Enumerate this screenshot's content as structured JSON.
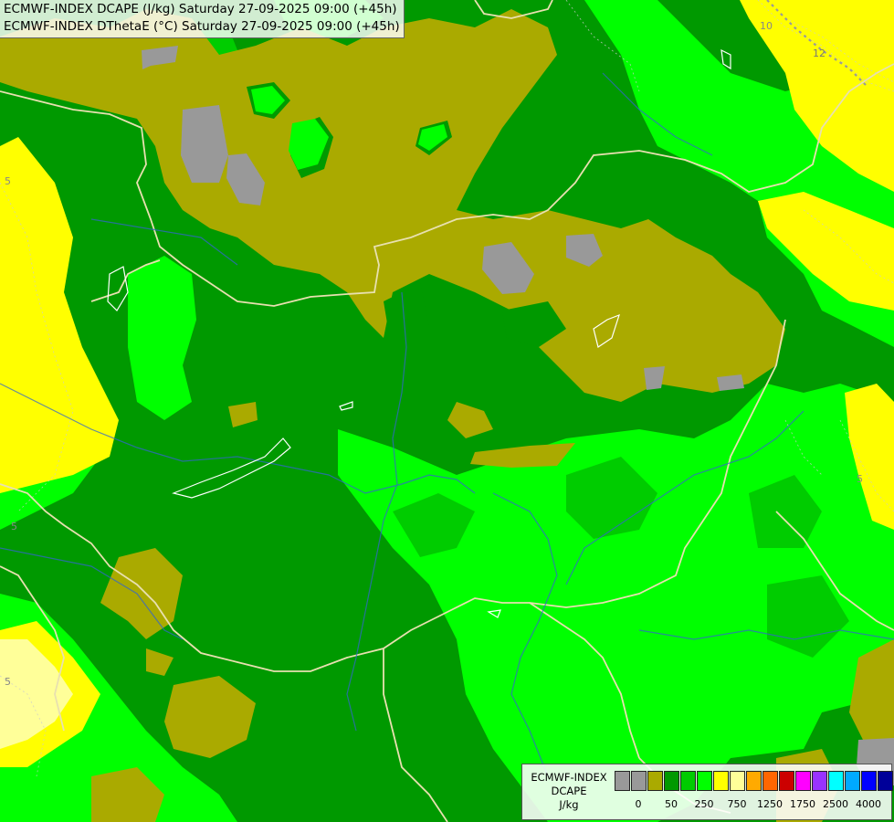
{
  "title": {
    "line1": "ECMWF-INDEX DCAPE (J/kg) Saturday 27-09-2025 09:00 (+45h)",
    "line2": "ECMWF-INDEX DThetaE (°C) Saturday 27-09-2025 09:00 (+45h)"
  },
  "legend": {
    "line1": "ECMWF-INDEX",
    "line2": "DCAPE",
    "unit": "J/kg",
    "colors": [
      "#999999",
      "#999999",
      "#aaaa00",
      "#009900",
      "#00cc00",
      "#00ff00",
      "#ffff00",
      "#ffff99",
      "#ffaa00",
      "#ff6600",
      "#cc0000",
      "#ff00ff",
      "#9933ff",
      "#00ffff",
      "#00aaff",
      "#0000ff",
      "#000099"
    ],
    "ticks": [
      "0",
      "50",
      "250",
      "750",
      "1250",
      "1750",
      "2500",
      "4000"
    ]
  },
  "contour_labels": [
    "5",
    "5",
    "5",
    "5",
    "10",
    "12"
  ],
  "colors": {
    "olive": "#aaaa00",
    "dark_green": "#009900",
    "medium_green": "#00cc00",
    "bright_green": "#00ff00",
    "yellow": "#ffff00",
    "pale_yellow": "#ffff99",
    "gray": "#999999",
    "border_line": "#e8e0b0",
    "river_line": "#3366cc"
  }
}
